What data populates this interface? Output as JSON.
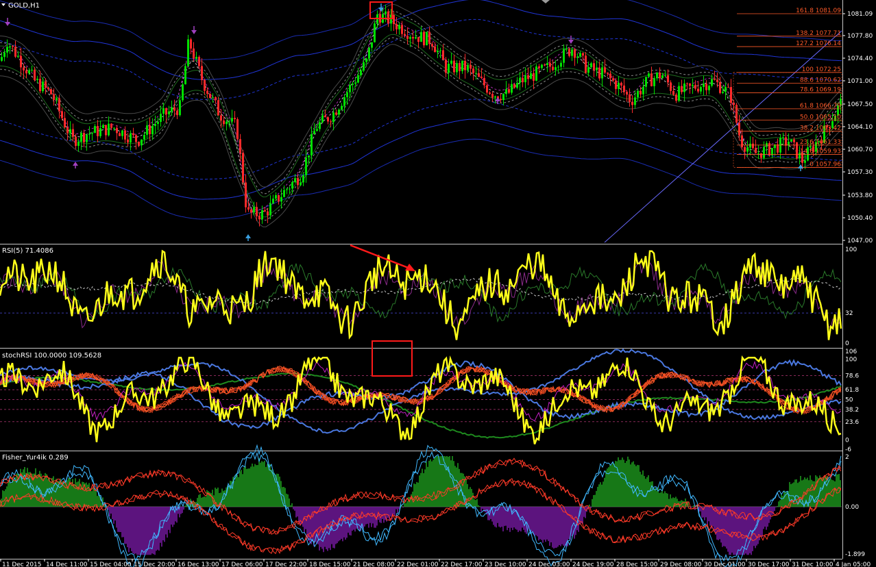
{
  "window": {
    "symbol_title": "GOLD,H1",
    "colors": {
      "background": "#000000",
      "bull_candle": "#00e000",
      "bear_candle": "#ff2a2a",
      "rsi_line": "#ffff1a",
      "fib_lines": "#ff5a28",
      "band_blue": "#2035d8",
      "annotation_red": "#ff1a1a"
    }
  },
  "main_panel": {
    "price_axis": [
      "1081.09",
      "1077.80",
      "1074.40",
      "1071.00",
      "1067.50",
      "1064.10",
      "1060.70",
      "1057.30",
      "1053.80",
      "1050.40",
      "1047.00"
    ],
    "fib_levels": [
      {
        "label": "161.8 1081.09",
        "value": 1081.09
      },
      {
        "label": "138.2 1077.71",
        "value": 1077.71
      },
      {
        "label": "127.2 1076.14",
        "value": 1076.14
      },
      {
        "label": "100 1072.25",
        "value": 1072.25
      },
      {
        "label": "88.6 1070.62",
        "value": 1070.62
      },
      {
        "label": "78.6 1069.19",
        "value": 1069.19
      },
      {
        "label": "61.8 1066.79",
        "value": 1066.79
      },
      {
        "label": "50.0 1065.10",
        "value": 1065.1
      },
      {
        "label": "38.2 1063.42",
        "value": 1063.42
      },
      {
        "label": "23.6 1061.33",
        "value": 1061.33
      },
      {
        "label": "14.6 1059.93",
        "value": 1059.93
      },
      {
        "label": "0 1057.96",
        "value": 1057.96
      }
    ]
  },
  "rsi_panel": {
    "title": "RSI(5) 71.4086",
    "levels": [
      "100",
      "32",
      "0"
    ]
  },
  "stoch_panel": {
    "title": "stochRSI 100.0000 109.5628",
    "levels": [
      "106",
      "100",
      "78.6",
      "61.8",
      "50",
      "38.2",
      "23.6",
      "0",
      "-6"
    ]
  },
  "fisher_panel": {
    "title": "Fisher_Yur4ik 0.289",
    "levels": [
      "2",
      "0.00",
      "-1.899"
    ]
  },
  "time_axis": [
    "11 Dec 2015",
    "14 Dec 11:00",
    "15 Dec 04:00",
    "15 Dec 20:00",
    "16 Dec 13:00",
    "17 Dec 06:00",
    "17 Dec 22:00",
    "18 Dec 15:00",
    "21 Dec 08:00",
    "22 Dec 01:00",
    "22 Dec 17:00",
    "23 Dec 10:00",
    "24 Dec 03:00",
    "24 Dec 19:00",
    "28 Dec 15:00",
    "29 Dec 08:00",
    "30 Dec 01:00",
    "30 Dec 17:00",
    "31 Dec 10:00",
    "4 Jan 05:00"
  ]
}
